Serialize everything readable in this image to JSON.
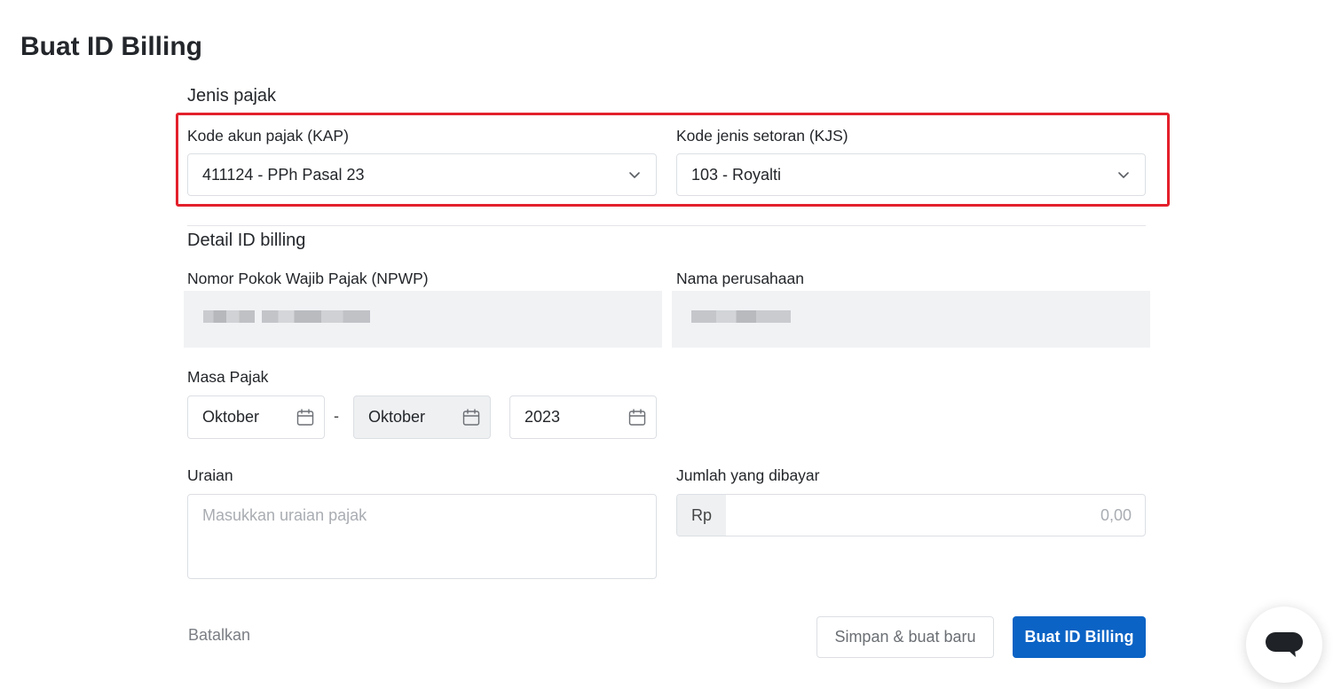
{
  "page": {
    "title": "Buat ID Billing"
  },
  "jenis_pajak": {
    "section_title": "Jenis pajak",
    "kap": {
      "label": "Kode akun pajak (KAP)",
      "value": "411124 - PPh Pasal 23"
    },
    "kjs": {
      "label": "Kode jenis setoran (KJS)",
      "value": "103 - Royalti"
    }
  },
  "detail": {
    "section_title": "Detail ID billing",
    "npwp": {
      "label": "Nomor Pokok Wajib Pajak (NPWP)"
    },
    "company": {
      "label": "Nama perusahaan"
    }
  },
  "masa_pajak": {
    "label": "Masa Pajak",
    "from_month": "Oktober",
    "separator": "-",
    "to_month": "Oktober",
    "year": "2023"
  },
  "uraian": {
    "label": "Uraian",
    "placeholder": "Masukkan uraian pajak"
  },
  "jumlah": {
    "label": "Jumlah yang dibayar",
    "prefix": "Rp",
    "value": "0,00"
  },
  "actions": {
    "cancel": "Batalkan",
    "save_new": "Simpan & buat baru",
    "submit": "Buat ID Billing"
  },
  "colors": {
    "primary": "#0b63c5",
    "highlight": "#e3202b"
  },
  "icons": {
    "select": "chevron-down-icon",
    "date": "calendar-icon",
    "chat": "chat-bubble-icon"
  }
}
